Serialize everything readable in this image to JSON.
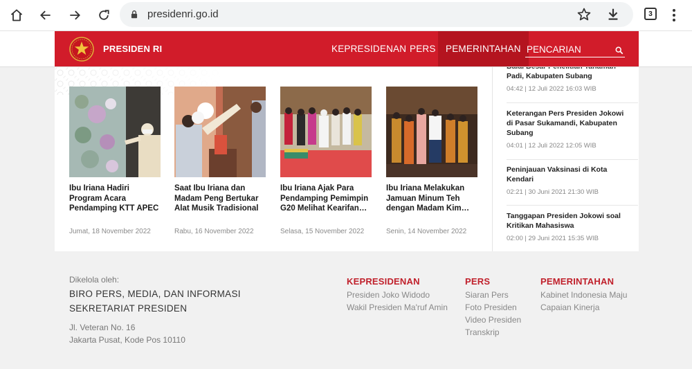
{
  "browser": {
    "url": "presidenri.go.id",
    "tab_count": "3"
  },
  "header": {
    "brand": "PRESIDEN RI",
    "nav": [
      "KEPRESIDENAN",
      "PERS",
      "PEMERINTAHAN"
    ],
    "active_nav": "PEMERINTAHAN",
    "search_placeholder": "PENCARIAN",
    "colors": {
      "primary": "#d11c2a",
      "active": "#b4141f",
      "footer_heading": "#c0202b"
    }
  },
  "cards": [
    {
      "title": "Ibu Iriana Hadiri Program Acara Pendamping KTT APEC",
      "date": "Jumat, 18 November 2022"
    },
    {
      "title": "Saat Ibu Iriana dan Madam Peng Bertukar Alat Musik Tradisional",
      "date": "Rabu, 16 November 2022"
    },
    {
      "title": "Ibu Iriana Ajak Para Pendamping Pemimpin G20 Melihat Kearifan…",
      "date": "Selasa, 15 November 2022"
    },
    {
      "title": "Ibu Iriana Melakukan Jamuan Minum Teh dengan Madam Kim…",
      "date": "Senin, 14 November 2022"
    }
  ],
  "sidebar": [
    {
      "title": "Balai Besar Penelitian Tanaman Padi, Kabupaten Subang",
      "meta": "04:42 | 12 Juli 2022 16:03 WIB"
    },
    {
      "title": "Keterangan Pers Presiden Jokowi di Pasar Sukamandi, Kabupaten Subang",
      "meta": "04:01 | 12 Juli 2022 12:05 WIB"
    },
    {
      "title": "Peninjauan Vaksinasi di Kota Kendari",
      "meta": "02:21 | 30 Juni 2021 21:30 WIB"
    },
    {
      "title": "Tanggapan Presiden Jokowi soal Kritikan Mahasiswa",
      "meta": "02:00 | 29 Juni 2021 15:35 WIB"
    }
  ],
  "footer": {
    "managed_label": "Dikelola oleh:",
    "org_line1": "BIRO PERS, MEDIA, DAN INFORMASI",
    "org_line2": "SEKRETARIAT PRESIDEN",
    "address_line1": "Jl. Veteran No. 16",
    "address_line2": "Jakarta Pusat, Kode Pos 10110",
    "columns": [
      {
        "heading": "KEPRESIDENAN",
        "links": [
          "Presiden Joko Widodo",
          "Wakil Presiden Ma'ruf Amin"
        ]
      },
      {
        "heading": "PERS",
        "links": [
          "Siaran Pers",
          "Foto Presiden",
          "Video Presiden",
          "Transkrip"
        ]
      },
      {
        "heading": "PEMERINTAHAN",
        "links": [
          "Kabinet Indonesia Maju",
          "Capaian Kinerja"
        ]
      }
    ]
  }
}
